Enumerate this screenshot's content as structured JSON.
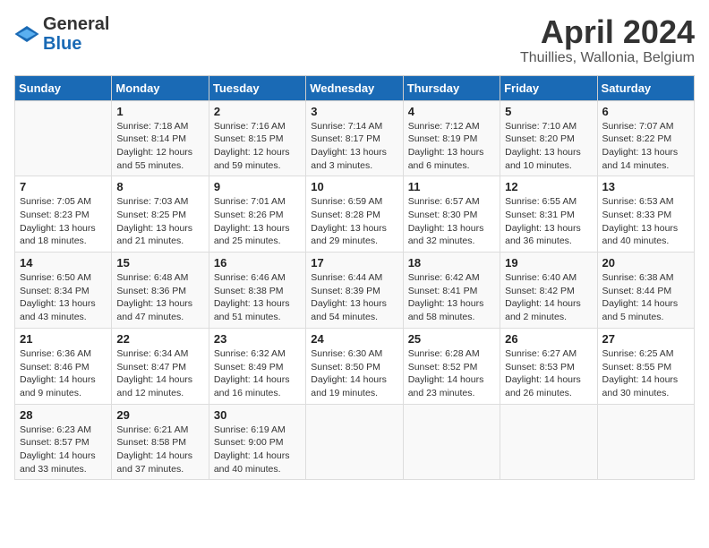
{
  "header": {
    "logo_general": "General",
    "logo_blue": "Blue",
    "month_title": "April 2024",
    "location": "Thuillies, Wallonia, Belgium"
  },
  "days_of_week": [
    "Sunday",
    "Monday",
    "Tuesday",
    "Wednesday",
    "Thursday",
    "Friday",
    "Saturday"
  ],
  "weeks": [
    [
      {
        "day": "",
        "sunrise": "",
        "sunset": "",
        "daylight": ""
      },
      {
        "day": "1",
        "sunrise": "Sunrise: 7:18 AM",
        "sunset": "Sunset: 8:14 PM",
        "daylight": "Daylight: 12 hours and 55 minutes."
      },
      {
        "day": "2",
        "sunrise": "Sunrise: 7:16 AM",
        "sunset": "Sunset: 8:15 PM",
        "daylight": "Daylight: 12 hours and 59 minutes."
      },
      {
        "day": "3",
        "sunrise": "Sunrise: 7:14 AM",
        "sunset": "Sunset: 8:17 PM",
        "daylight": "Daylight: 13 hours and 3 minutes."
      },
      {
        "day": "4",
        "sunrise": "Sunrise: 7:12 AM",
        "sunset": "Sunset: 8:19 PM",
        "daylight": "Daylight: 13 hours and 6 minutes."
      },
      {
        "day": "5",
        "sunrise": "Sunrise: 7:10 AM",
        "sunset": "Sunset: 8:20 PM",
        "daylight": "Daylight: 13 hours and 10 minutes."
      },
      {
        "day": "6",
        "sunrise": "Sunrise: 7:07 AM",
        "sunset": "Sunset: 8:22 PM",
        "daylight": "Daylight: 13 hours and 14 minutes."
      }
    ],
    [
      {
        "day": "7",
        "sunrise": "Sunrise: 7:05 AM",
        "sunset": "Sunset: 8:23 PM",
        "daylight": "Daylight: 13 hours and 18 minutes."
      },
      {
        "day": "8",
        "sunrise": "Sunrise: 7:03 AM",
        "sunset": "Sunset: 8:25 PM",
        "daylight": "Daylight: 13 hours and 21 minutes."
      },
      {
        "day": "9",
        "sunrise": "Sunrise: 7:01 AM",
        "sunset": "Sunset: 8:26 PM",
        "daylight": "Daylight: 13 hours and 25 minutes."
      },
      {
        "day": "10",
        "sunrise": "Sunrise: 6:59 AM",
        "sunset": "Sunset: 8:28 PM",
        "daylight": "Daylight: 13 hours and 29 minutes."
      },
      {
        "day": "11",
        "sunrise": "Sunrise: 6:57 AM",
        "sunset": "Sunset: 8:30 PM",
        "daylight": "Daylight: 13 hours and 32 minutes."
      },
      {
        "day": "12",
        "sunrise": "Sunrise: 6:55 AM",
        "sunset": "Sunset: 8:31 PM",
        "daylight": "Daylight: 13 hours and 36 minutes."
      },
      {
        "day": "13",
        "sunrise": "Sunrise: 6:53 AM",
        "sunset": "Sunset: 8:33 PM",
        "daylight": "Daylight: 13 hours and 40 minutes."
      }
    ],
    [
      {
        "day": "14",
        "sunrise": "Sunrise: 6:50 AM",
        "sunset": "Sunset: 8:34 PM",
        "daylight": "Daylight: 13 hours and 43 minutes."
      },
      {
        "day": "15",
        "sunrise": "Sunrise: 6:48 AM",
        "sunset": "Sunset: 8:36 PM",
        "daylight": "Daylight: 13 hours and 47 minutes."
      },
      {
        "day": "16",
        "sunrise": "Sunrise: 6:46 AM",
        "sunset": "Sunset: 8:38 PM",
        "daylight": "Daylight: 13 hours and 51 minutes."
      },
      {
        "day": "17",
        "sunrise": "Sunrise: 6:44 AM",
        "sunset": "Sunset: 8:39 PM",
        "daylight": "Daylight: 13 hours and 54 minutes."
      },
      {
        "day": "18",
        "sunrise": "Sunrise: 6:42 AM",
        "sunset": "Sunset: 8:41 PM",
        "daylight": "Daylight: 13 hours and 58 minutes."
      },
      {
        "day": "19",
        "sunrise": "Sunrise: 6:40 AM",
        "sunset": "Sunset: 8:42 PM",
        "daylight": "Daylight: 14 hours and 2 minutes."
      },
      {
        "day": "20",
        "sunrise": "Sunrise: 6:38 AM",
        "sunset": "Sunset: 8:44 PM",
        "daylight": "Daylight: 14 hours and 5 minutes."
      }
    ],
    [
      {
        "day": "21",
        "sunrise": "Sunrise: 6:36 AM",
        "sunset": "Sunset: 8:46 PM",
        "daylight": "Daylight: 14 hours and 9 minutes."
      },
      {
        "day": "22",
        "sunrise": "Sunrise: 6:34 AM",
        "sunset": "Sunset: 8:47 PM",
        "daylight": "Daylight: 14 hours and 12 minutes."
      },
      {
        "day": "23",
        "sunrise": "Sunrise: 6:32 AM",
        "sunset": "Sunset: 8:49 PM",
        "daylight": "Daylight: 14 hours and 16 minutes."
      },
      {
        "day": "24",
        "sunrise": "Sunrise: 6:30 AM",
        "sunset": "Sunset: 8:50 PM",
        "daylight": "Daylight: 14 hours and 19 minutes."
      },
      {
        "day": "25",
        "sunrise": "Sunrise: 6:28 AM",
        "sunset": "Sunset: 8:52 PM",
        "daylight": "Daylight: 14 hours and 23 minutes."
      },
      {
        "day": "26",
        "sunrise": "Sunrise: 6:27 AM",
        "sunset": "Sunset: 8:53 PM",
        "daylight": "Daylight: 14 hours and 26 minutes."
      },
      {
        "day": "27",
        "sunrise": "Sunrise: 6:25 AM",
        "sunset": "Sunset: 8:55 PM",
        "daylight": "Daylight: 14 hours and 30 minutes."
      }
    ],
    [
      {
        "day": "28",
        "sunrise": "Sunrise: 6:23 AM",
        "sunset": "Sunset: 8:57 PM",
        "daylight": "Daylight: 14 hours and 33 minutes."
      },
      {
        "day": "29",
        "sunrise": "Sunrise: 6:21 AM",
        "sunset": "Sunset: 8:58 PM",
        "daylight": "Daylight: 14 hours and 37 minutes."
      },
      {
        "day": "30",
        "sunrise": "Sunrise: 6:19 AM",
        "sunset": "Sunset: 9:00 PM",
        "daylight": "Daylight: 14 hours and 40 minutes."
      },
      {
        "day": "",
        "sunrise": "",
        "sunset": "",
        "daylight": ""
      },
      {
        "day": "",
        "sunrise": "",
        "sunset": "",
        "daylight": ""
      },
      {
        "day": "",
        "sunrise": "",
        "sunset": "",
        "daylight": ""
      },
      {
        "day": "",
        "sunrise": "",
        "sunset": "",
        "daylight": ""
      }
    ]
  ]
}
